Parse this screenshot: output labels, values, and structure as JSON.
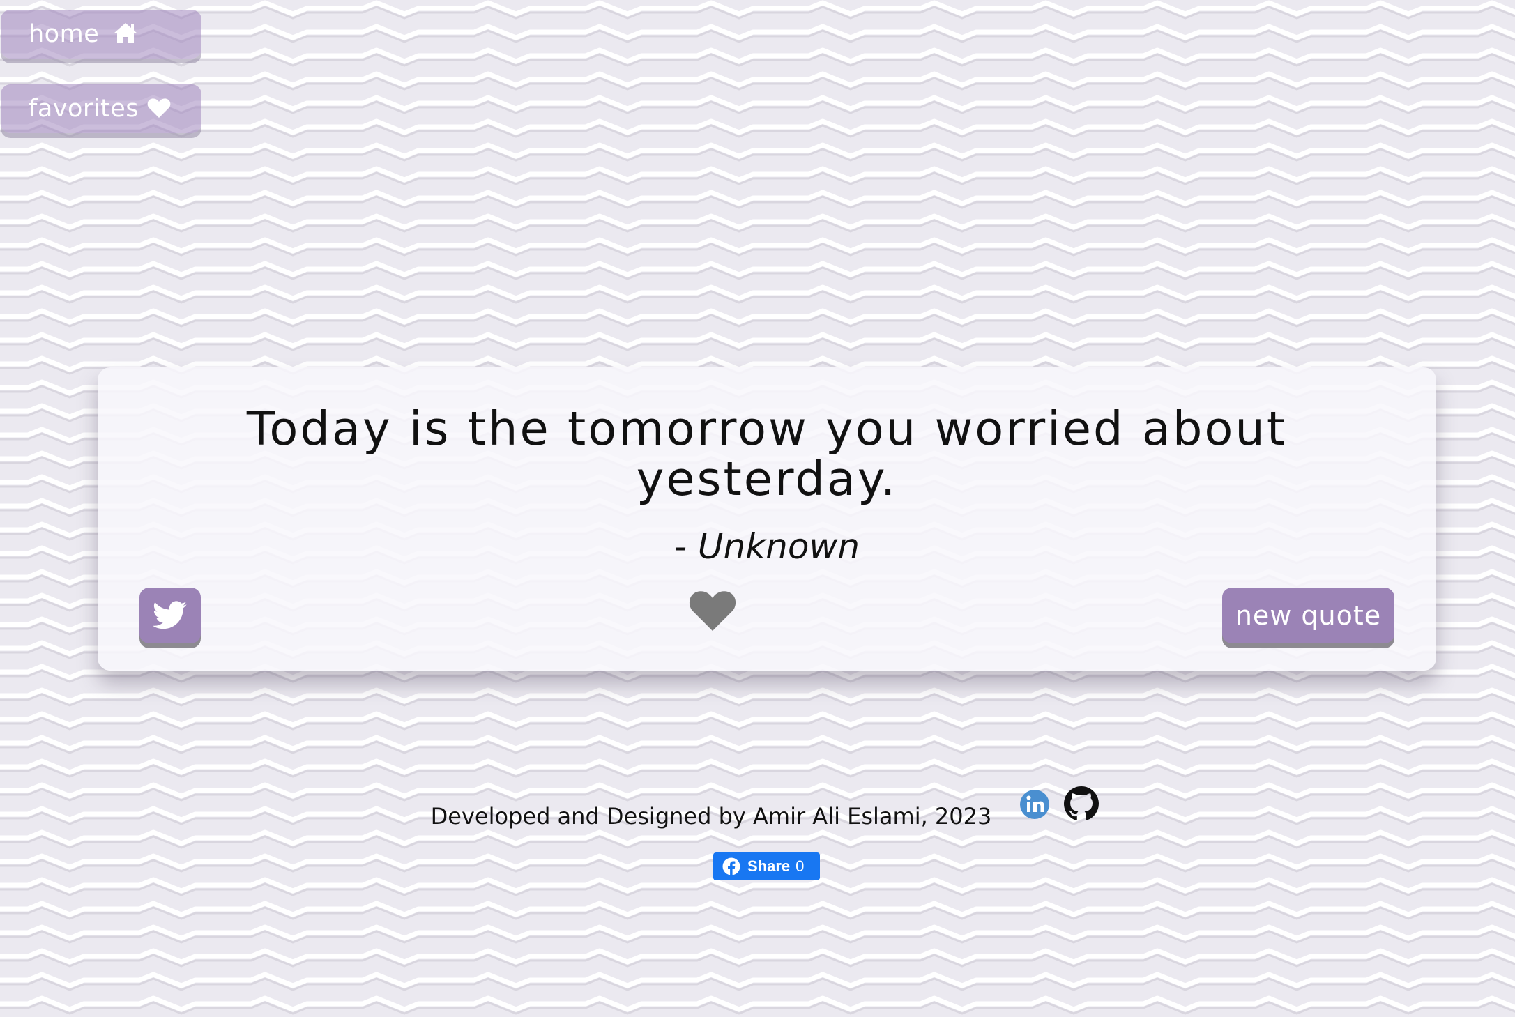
{
  "nav": {
    "home": {
      "label": "home",
      "icon": "home-icon"
    },
    "favorites": {
      "label": "favorites",
      "icon": "heart-icon"
    }
  },
  "quote": {
    "text": "Today is the tomorrow you worried about yesterday.",
    "author": "- Unknown"
  },
  "actions": {
    "tweet_icon": "twitter-icon",
    "favorite_icon": "heart-icon",
    "new_quote_label": "new quote"
  },
  "footer": {
    "credit": "Developed and Designed by Amir Ali Eslami, 2023",
    "social_icons": [
      "linkedin-icon",
      "github-icon"
    ],
    "share": {
      "label": "Share",
      "count": "0"
    }
  },
  "colors": {
    "background": "#ebe9f0",
    "accent": "#9b83b6",
    "heart": "#7a7a7a",
    "facebook": "#1877f2",
    "linkedin": "#4a8fd0"
  }
}
